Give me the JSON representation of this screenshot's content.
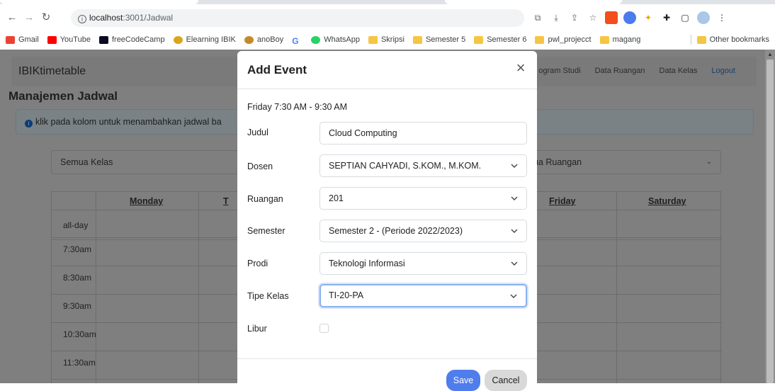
{
  "browser": {
    "url_host": "localhost",
    "url_path": ":3001/Jadwal",
    "bookmarks": [
      "Gmail",
      "YouTube",
      "freeCodeCamp",
      "Elearning IBIK",
      "anoBoy",
      "WhatsApp",
      "Skripsi",
      "Semester 5",
      "Semester 6",
      "pwl_projecct",
      "magang"
    ],
    "other_bookmarks": "Other bookmarks"
  },
  "navbar": {
    "brand": "IBIKtimetable",
    "links": [
      "ogram Studi",
      "Data Ruangan",
      "Data Kelas",
      "Logout"
    ]
  },
  "page": {
    "title": "Manajemen Jadwal",
    "alert": "klik pada kolom untuk menambahkan jadwal ba",
    "class_filter": "Semua Kelas",
    "room_filter": "ua Ruangan"
  },
  "calendar": {
    "days": [
      "Monday",
      "T",
      "Friday",
      "Saturday"
    ],
    "times": [
      "all-day",
      "7:30am",
      "8:30am",
      "9:30am",
      "10:30am",
      "11:30am"
    ]
  },
  "modal": {
    "title": "Add Event",
    "time_range": "Friday 7:30 AM - 9:30 AM",
    "labels": {
      "judul": "Judul",
      "dosen": "Dosen",
      "ruangan": "Ruangan",
      "semester": "Semester",
      "prodi": "Prodi",
      "tipe_kelas": "Tipe Kelas",
      "libur": "Libur"
    },
    "values": {
      "judul": "Cloud Computing",
      "dosen": "SEPTIAN CAHYADI, S.KOM., M.KOM.",
      "ruangan": "201",
      "semester": "Semester 2 - (Periode 2022/2023)",
      "prodi": "Teknologi Informasi",
      "tipe_kelas": "TI-20-PA"
    },
    "save_label": "Save",
    "cancel_label": "Cancel"
  },
  "colors": {
    "accent": "#4f7dec",
    "focus_ring": "#8ab1f3"
  }
}
